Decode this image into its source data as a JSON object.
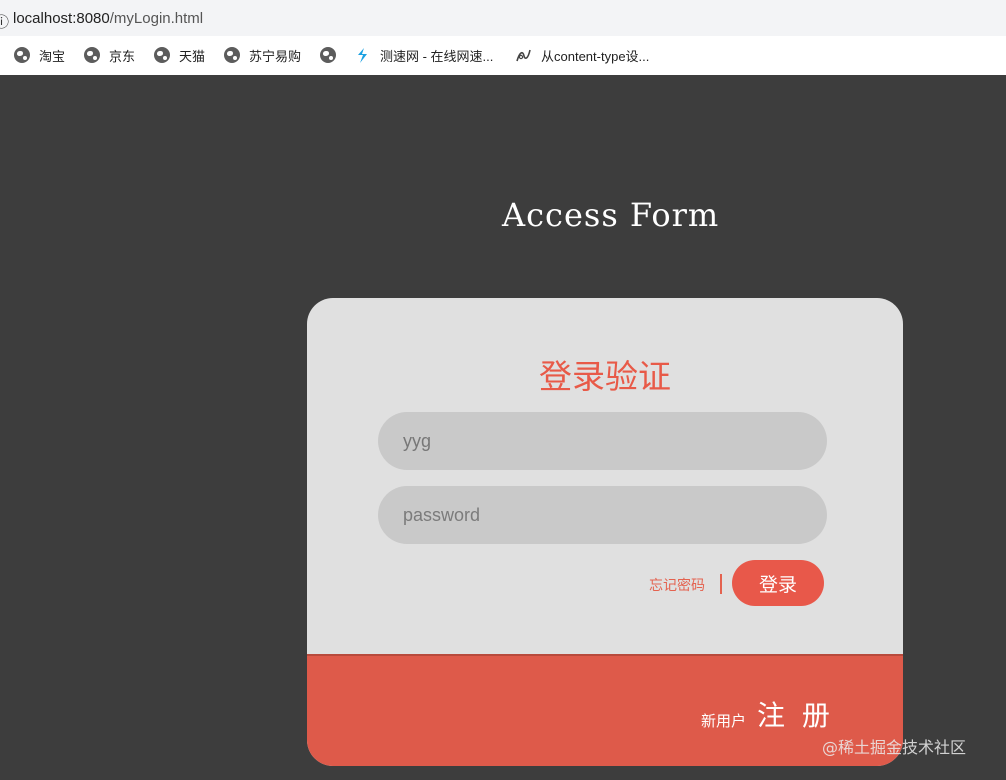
{
  "browser": {
    "url_host": "localhost:8080",
    "url_path": "/myLogin.html",
    "bookmarks": [
      {
        "label": "淘宝",
        "icon": "globe-icon"
      },
      {
        "label": "京东",
        "icon": "globe-icon"
      },
      {
        "label": "天猫",
        "icon": "globe-icon"
      },
      {
        "label": "苏宁易购",
        "icon": "globe-icon"
      },
      {
        "label": "",
        "icon": "globe-icon"
      },
      {
        "label": "测速网 - 在线网速...",
        "icon": "speedtest-icon"
      },
      {
        "label": "从content-type设...",
        "icon": "pen-icon"
      }
    ]
  },
  "page": {
    "title": "Access Form"
  },
  "login": {
    "heading": "登录验证",
    "username_value": "yyg",
    "password_placeholder": "password",
    "forgot_label": "忘记密码",
    "login_button": "登录"
  },
  "footer": {
    "new_user_label": "新用户",
    "register_label": "注 册"
  },
  "watermark": "@稀土掘金技术社区",
  "colors": {
    "background": "#3d3d3d",
    "card": "#e0e0e0",
    "accent": "#e8584a",
    "input": "#c9c9c9"
  }
}
